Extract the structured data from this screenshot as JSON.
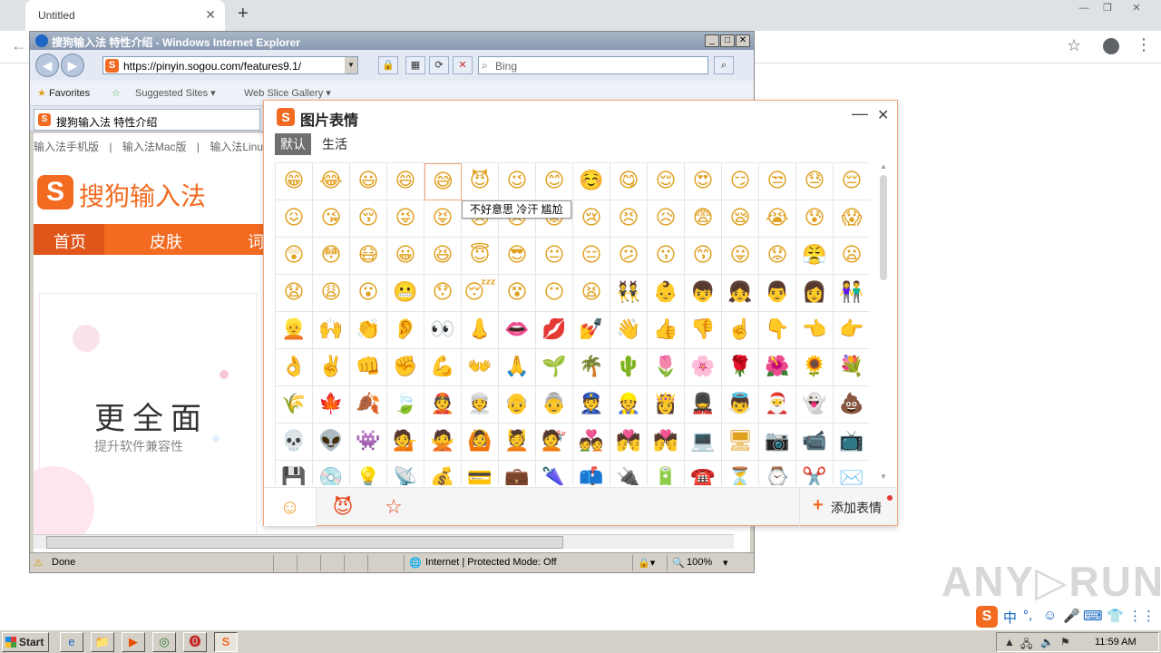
{
  "chrome": {
    "tab_title": "Untitled",
    "tab_close": "✕",
    "new_tab": "+",
    "back": "←",
    "star": "☆",
    "menu": "⋮",
    "window_controls": [
      "—",
      "❐",
      "✕"
    ]
  },
  "ie": {
    "title": "搜狗输入法 特性介绍 - Windows Internet Explorer",
    "controls": [
      "_",
      "□",
      "✕"
    ],
    "url": "https://pinyin.sogou.com/features9.1/",
    "search_placeholder": "Bing",
    "favorites": {
      "favorites_label": "Favorites",
      "suggested_sites": "Suggested Sites ▾",
      "web_slice_gallery": "Web Slice Gallery ▾"
    },
    "tab_title": "搜狗输入法 特性介绍",
    "status": {
      "done": "Done",
      "zone": "Internet | Protected Mode: Off",
      "zoom": "100%"
    }
  },
  "site": {
    "topnav": [
      "输入法手机版",
      "|",
      "输入法Mac版",
      "|",
      "输入法Linux"
    ],
    "logo_mark": "S",
    "logo_text": "搜狗输入法",
    "menu": [
      "首页",
      "皮肤",
      "词"
    ],
    "feature_title": "更全面",
    "feature_subtitle": "提升软件兼容性"
  },
  "emoji_panel": {
    "logo": "S",
    "title": "图片表情",
    "minimize": "—",
    "close": "✕",
    "tabs": [
      "默认",
      "生活"
    ],
    "active_tab": 0,
    "tooltip": "不好意思 冷汗 尴尬",
    "hover_cell": {
      "row": 0,
      "col": 4
    },
    "grid": [
      [
        "😁",
        "😂",
        "😃",
        "😄",
        "😅",
        "😈",
        "😉",
        "😊",
        "☺️",
        "😋",
        "😌",
        "😍",
        "😏",
        "😒",
        "😓",
        "😔"
      ],
      [
        "😖",
        "😘",
        "😚",
        "😜",
        "😝",
        "😞",
        "😠",
        "😡",
        "😢",
        "😣",
        "😥",
        "😨",
        "😪",
        "😭",
        "😰",
        "😱"
      ],
      [
        "😲",
        "😳",
        "😷",
        "😀",
        "😆",
        "😇",
        "😎",
        "😐",
        "😑",
        "😕",
        "😗",
        "😙",
        "😛",
        "😟",
        "😤",
        "😦"
      ],
      [
        "😧",
        "😩",
        "😮",
        "😬",
        "😯",
        "😴",
        "😵",
        "😶",
        "😫",
        "👯",
        "👶",
        "👦",
        "👧",
        "👨",
        "👩",
        "👫"
      ],
      [
        "👱",
        "🙌",
        "👏",
        "👂",
        "👀",
        "👃",
        "👄",
        "💋",
        "💅",
        "👋",
        "👍",
        "👎",
        "☝️",
        "👇",
        "👈",
        "👉"
      ],
      [
        "👌",
        "✌️",
        "👊",
        "✊",
        "💪",
        "👐",
        "🙏",
        "🌱",
        "🌴",
        "🌵",
        "🌷",
        "🌸",
        "🌹",
        "🌺",
        "🌻",
        "💐"
      ],
      [
        "🌾",
        "🍁",
        "🍂",
        "🍃",
        "👲",
        "👳",
        "👴",
        "👵",
        "👮",
        "👷",
        "👸",
        "💂",
        "👼",
        "🎅",
        "👻",
        "💩"
      ],
      [
        "💀",
        "👽",
        "👾",
        "💁",
        "🙅",
        "🙆",
        "💆",
        "💇",
        "💑",
        "💏",
        "💏",
        "💻",
        "🖥",
        "📷",
        "📹",
        "📺"
      ],
      [
        "💾",
        "💿",
        "💡",
        "📡",
        "💰",
        "💳",
        "💼",
        "🌂",
        "📫",
        "🔌",
        "🔋",
        "☎️",
        "⏳",
        "⌚",
        "✂️",
        "✉️"
      ]
    ],
    "footer": {
      "tabs": [
        "☺",
        "😈",
        "☆"
      ],
      "add_label": "添加表情",
      "add_icon": "+"
    }
  },
  "watermark": "ANY▷RUN",
  "taskbar": {
    "start": "Start",
    "apps": [
      "e",
      "📁",
      "▶",
      "◎",
      "⓿",
      "S"
    ],
    "ime": [
      "中",
      "°,",
      "☺",
      "🎤",
      "⌨",
      "👕",
      "⋮⋮"
    ],
    "clock": "11:59 AM"
  }
}
